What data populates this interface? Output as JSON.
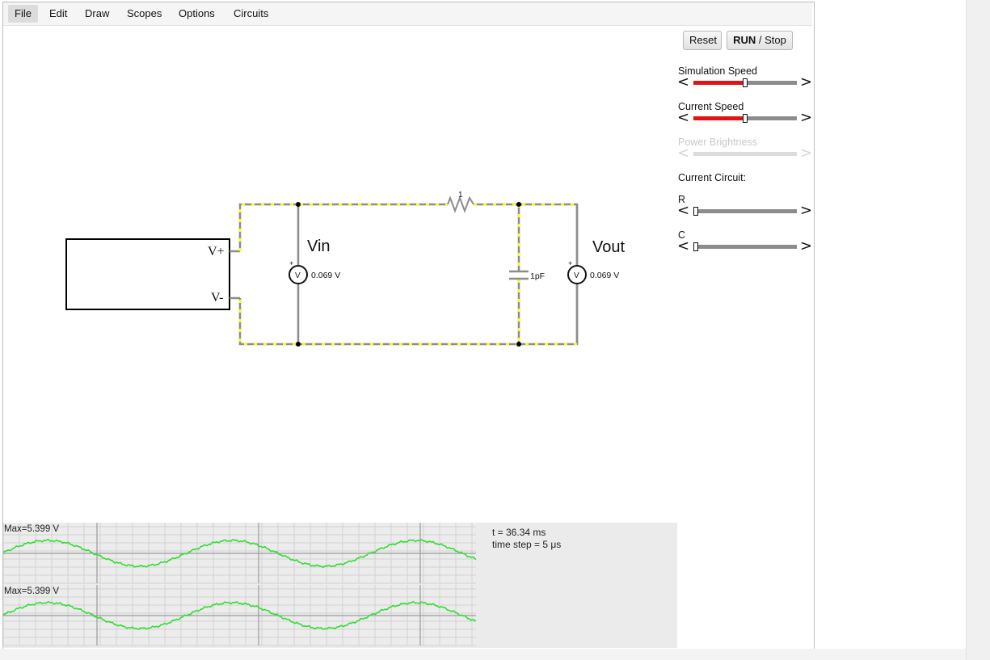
{
  "menu": [
    "File",
    "Edit",
    "Draw",
    "Scopes",
    "Options",
    "Circuits"
  ],
  "buttons": {
    "reset": "Reset",
    "run_bold": "RUN",
    "run_rest": " / Stop"
  },
  "panel": {
    "sim_speed": "Simulation Speed",
    "current_speed": "Current Speed",
    "power_brightness": "Power Brightness",
    "current_circuit": "Current Circuit:",
    "r_label": "R",
    "c_label": "C",
    "arrow_left": "<",
    "arrow_right": ">"
  },
  "sliders": {
    "simulation_speed": 0.5,
    "current_speed": 0.5,
    "power_brightness": 0.0,
    "r": 0.0,
    "c": 0.0
  },
  "circuit": {
    "source_plus": "V+",
    "source_minus": "V-",
    "vin_label": "Vin",
    "vout_label": "Vout",
    "meter_symbol": "V",
    "meter_plus": "+",
    "vin_reading": "0.069 V",
    "vout_reading": "0.069 V",
    "resistor_value": "1",
    "capacitor_value": "1pF"
  },
  "scopes": [
    {
      "max_label": "Max=5.399 V"
    },
    {
      "max_label": "Max=5.399 V"
    }
  ],
  "scope_info": {
    "time": "t = 36.34 ms",
    "time_step": "time step = 5 μs"
  },
  "colors": {
    "wire": "#8c8c8c",
    "current_dots": "#ffff00",
    "trace": "#33dd33",
    "slider_fill": "#e01414"
  }
}
